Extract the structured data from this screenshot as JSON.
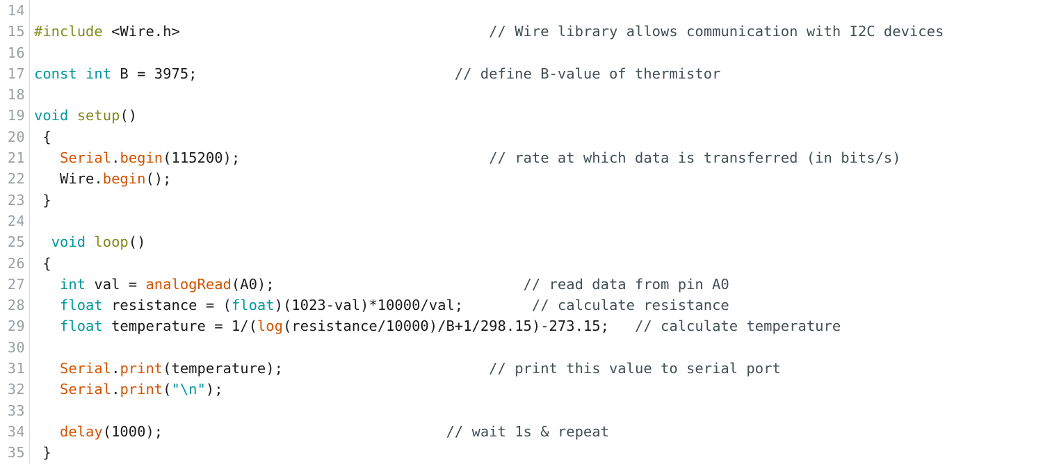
{
  "editor": {
    "language": "arduino-c",
    "first_line_number": 14,
    "last_line_number": 35,
    "background_color": "#ffffff",
    "gutter_color": "#9aa0a6",
    "gutter_rule_color": "#d8dadd",
    "comment_column_text": "comments aligned to right column"
  },
  "colors": {
    "keyword": "#00979c",
    "function": "#d35400",
    "preprocessor": "#7e8b1c",
    "function_name": "#7e8b1c",
    "string": "#00979c",
    "comment": "#434f54",
    "plain": "#1b1b1b"
  },
  "lines": [
    {
      "number": "14",
      "tokens": []
    },
    {
      "number": "15",
      "tokens": [
        {
          "t": "#include",
          "c": "preproc"
        },
        {
          "t": " <Wire.h>",
          "c": "plain"
        },
        {
          "t": "                                    ",
          "c": "plain"
        },
        {
          "t": "// Wire library allows communication with I2C devices",
          "c": "comment"
        }
      ]
    },
    {
      "number": "16",
      "tokens": []
    },
    {
      "number": "17",
      "tokens": [
        {
          "t": "const",
          "c": "keyword"
        },
        {
          "t": " ",
          "c": "plain"
        },
        {
          "t": "int",
          "c": "keyword"
        },
        {
          "t": " B = 3975;",
          "c": "plain"
        },
        {
          "t": "                              ",
          "c": "plain"
        },
        {
          "t": "// define B-value of thermistor",
          "c": "comment"
        }
      ]
    },
    {
      "number": "18",
      "tokens": []
    },
    {
      "number": "19",
      "tokens": [
        {
          "t": "void",
          "c": "keyword"
        },
        {
          "t": " ",
          "c": "plain"
        },
        {
          "t": "setup",
          "c": "funcname"
        },
        {
          "t": "()",
          "c": "plain"
        }
      ]
    },
    {
      "number": "20",
      "tokens": [
        {
          "t": " {",
          "c": "plain"
        }
      ]
    },
    {
      "number": "21",
      "tokens": [
        {
          "t": "   ",
          "c": "plain"
        },
        {
          "t": "Serial",
          "c": "function"
        },
        {
          "t": ".",
          "c": "plain"
        },
        {
          "t": "begin",
          "c": "function"
        },
        {
          "t": "(115200);",
          "c": "plain"
        },
        {
          "t": "                             ",
          "c": "plain"
        },
        {
          "t": "// rate at which data is transferred (in bits/s)",
          "c": "comment"
        }
      ]
    },
    {
      "number": "22",
      "tokens": [
        {
          "t": "   Wire.",
          "c": "plain"
        },
        {
          "t": "begin",
          "c": "function"
        },
        {
          "t": "();",
          "c": "plain"
        }
      ]
    },
    {
      "number": "23",
      "tokens": [
        {
          "t": " }",
          "c": "plain"
        }
      ]
    },
    {
      "number": "24",
      "tokens": []
    },
    {
      "number": "25",
      "tokens": [
        {
          "t": "  ",
          "c": "plain"
        },
        {
          "t": "void",
          "c": "keyword"
        },
        {
          "t": " ",
          "c": "plain"
        },
        {
          "t": "loop",
          "c": "funcname"
        },
        {
          "t": "()",
          "c": "plain"
        }
      ]
    },
    {
      "number": "26",
      "tokens": [
        {
          "t": " {",
          "c": "plain"
        }
      ]
    },
    {
      "number": "27",
      "tokens": [
        {
          "t": "   ",
          "c": "plain"
        },
        {
          "t": "int",
          "c": "keyword"
        },
        {
          "t": " val = ",
          "c": "plain"
        },
        {
          "t": "analogRead",
          "c": "function"
        },
        {
          "t": "(A0);",
          "c": "plain"
        },
        {
          "t": "                             ",
          "c": "plain"
        },
        {
          "t": "// read data from pin A0",
          "c": "comment"
        }
      ]
    },
    {
      "number": "28",
      "tokens": [
        {
          "t": "   ",
          "c": "plain"
        },
        {
          "t": "float",
          "c": "keyword"
        },
        {
          "t": " resistance = (",
          "c": "plain"
        },
        {
          "t": "float",
          "c": "keyword"
        },
        {
          "t": ")(1023-val)*10000/val;",
          "c": "plain"
        },
        {
          "t": "        ",
          "c": "plain"
        },
        {
          "t": "// calculate resistance",
          "c": "comment"
        }
      ]
    },
    {
      "number": "29",
      "tokens": [
        {
          "t": "   ",
          "c": "plain"
        },
        {
          "t": "float",
          "c": "keyword"
        },
        {
          "t": " temperature = 1/(",
          "c": "plain"
        },
        {
          "t": "log",
          "c": "function"
        },
        {
          "t": "(resistance/10000)/B+1/298.15)-273.15;",
          "c": "plain"
        },
        {
          "t": "   ",
          "c": "plain"
        },
        {
          "t": "// calculate temperature",
          "c": "comment"
        }
      ]
    },
    {
      "number": "30",
      "tokens": []
    },
    {
      "number": "31",
      "tokens": [
        {
          "t": "   ",
          "c": "plain"
        },
        {
          "t": "Serial",
          "c": "function"
        },
        {
          "t": ".",
          "c": "plain"
        },
        {
          "t": "print",
          "c": "function"
        },
        {
          "t": "(temperature);",
          "c": "plain"
        },
        {
          "t": "                        ",
          "c": "plain"
        },
        {
          "t": "// print this value to serial port",
          "c": "comment"
        }
      ]
    },
    {
      "number": "32",
      "tokens": [
        {
          "t": "   ",
          "c": "plain"
        },
        {
          "t": "Serial",
          "c": "function"
        },
        {
          "t": ".",
          "c": "plain"
        },
        {
          "t": "print",
          "c": "function"
        },
        {
          "t": "(",
          "c": "plain"
        },
        {
          "t": "\"\\n\"",
          "c": "string"
        },
        {
          "t": ");",
          "c": "plain"
        }
      ]
    },
    {
      "number": "33",
      "tokens": []
    },
    {
      "number": "34",
      "tokens": [
        {
          "t": "   ",
          "c": "plain"
        },
        {
          "t": "delay",
          "c": "function"
        },
        {
          "t": "(1000);",
          "c": "plain"
        },
        {
          "t": "                                 ",
          "c": "plain"
        },
        {
          "t": "// wait 1s & repeat",
          "c": "comment"
        }
      ]
    },
    {
      "number": "35",
      "tokens": [
        {
          "t": " }",
          "c": "plain"
        }
      ]
    }
  ]
}
